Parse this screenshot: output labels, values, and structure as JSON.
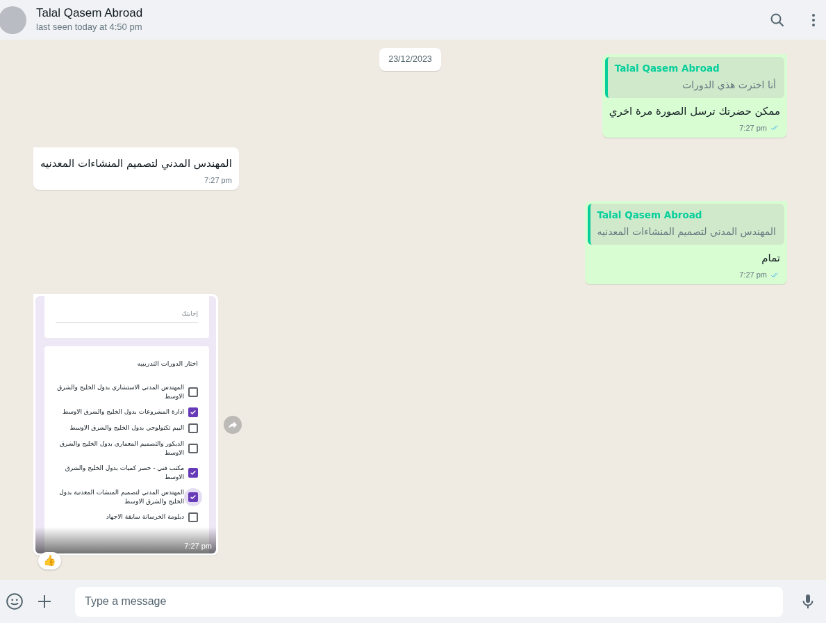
{
  "header": {
    "name": "Talal Qasem Abroad",
    "status": "last seen today at 4:50 pm"
  },
  "date_chip": "23/12/2023",
  "messages": [
    {
      "outgoing": true,
      "kind": "text",
      "quote": {
        "author": "Talal Qasem Abroad",
        "text": "أنا اخترت هذي الدورات"
      },
      "text": "ممكن حضرتك ترسل الصورة مرة اخري",
      "time": "7:27 pm",
      "read": true
    },
    {
      "outgoing": false,
      "kind": "text",
      "text": "المهندس المدني لتصميم المنشاءات المعدنيه",
      "time": "7:27 pm"
    },
    {
      "outgoing": true,
      "kind": "text",
      "quote": {
        "author": "Talal Qasem Abroad",
        "text": "المهندس المدني لتصميم المنشاءات المعدنيه"
      },
      "text": "تمام",
      "time": "7:27 pm",
      "read": true
    },
    {
      "outgoing": false,
      "kind": "image",
      "form": {
        "answer_placeholder": "إجابتك",
        "question": "اختار الدورات التدريبيه",
        "options": [
          {
            "label": "المهندس المدني الاستشاري بدول الخليج والشرق الاوسط",
            "checked": false,
            "focused": false
          },
          {
            "label": "ادارة المشروعات بدول الخليج والشرق الاوسط",
            "checked": true,
            "focused": false
          },
          {
            "label": "البيم تكنولوجي بدول الخليج والشرق الاوسط",
            "checked": false,
            "focused": false
          },
          {
            "label": "الديكور والتصميم المعماري بدول الخليج والشرق الاوسط",
            "checked": false,
            "focused": false
          },
          {
            "label": "مكتب فني - حصر كميات بدول الخليج والشرق الاوسط",
            "checked": true,
            "focused": false
          },
          {
            "label": "المهندس المدني لتصميم المنشات المعدنية بدول الخليج والشرق الاوسط",
            "checked": true,
            "focused": true
          },
          {
            "label": "دبلومة الخرسانة سابقة الاجهاد",
            "checked": false,
            "focused": false
          }
        ]
      },
      "time": "7:27 pm",
      "reaction": "👍"
    }
  ],
  "composer": {
    "placeholder": "Type a message"
  }
}
